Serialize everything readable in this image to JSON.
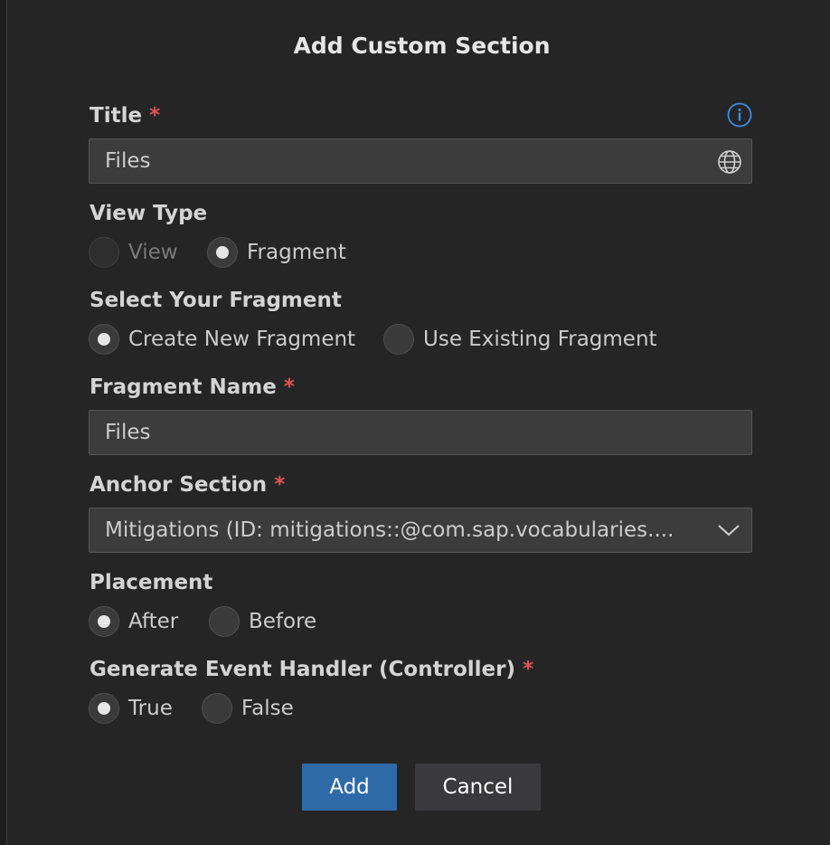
{
  "dialog": {
    "title": "Add Custom Section"
  },
  "title_field": {
    "label": "Title",
    "required": "*",
    "value": "Files"
  },
  "view_type": {
    "label": "View Type",
    "options": [
      {
        "label": "View",
        "selected": false,
        "disabled": true
      },
      {
        "label": "Fragment",
        "selected": true,
        "disabled": false
      }
    ]
  },
  "select_fragment": {
    "label": "Select Your Fragment",
    "options": [
      {
        "label": "Create New Fragment",
        "selected": true
      },
      {
        "label": "Use Existing Fragment",
        "selected": false
      }
    ]
  },
  "fragment_name": {
    "label": "Fragment Name",
    "required": "*",
    "value": "Files"
  },
  "anchor_section": {
    "label": "Anchor Section",
    "required": "*",
    "value": "Mitigations (ID: mitigations::@com.sap.vocabularies...."
  },
  "placement": {
    "label": "Placement",
    "options": [
      {
        "label": "After",
        "selected": true
      },
      {
        "label": "Before",
        "selected": false
      }
    ]
  },
  "event_handler": {
    "label": "Generate Event Handler (Controller)",
    "required": "*",
    "options": [
      {
        "label": "True",
        "selected": true
      },
      {
        "label": "False",
        "selected": false
      }
    ]
  },
  "buttons": {
    "add": "Add",
    "cancel": "Cancel"
  },
  "colors": {
    "background": "#252526",
    "field": "#3c3c3c",
    "primary_button": "#2e6aa8",
    "required_marker": "#e05252",
    "info_icon": "#3a8ee6"
  }
}
